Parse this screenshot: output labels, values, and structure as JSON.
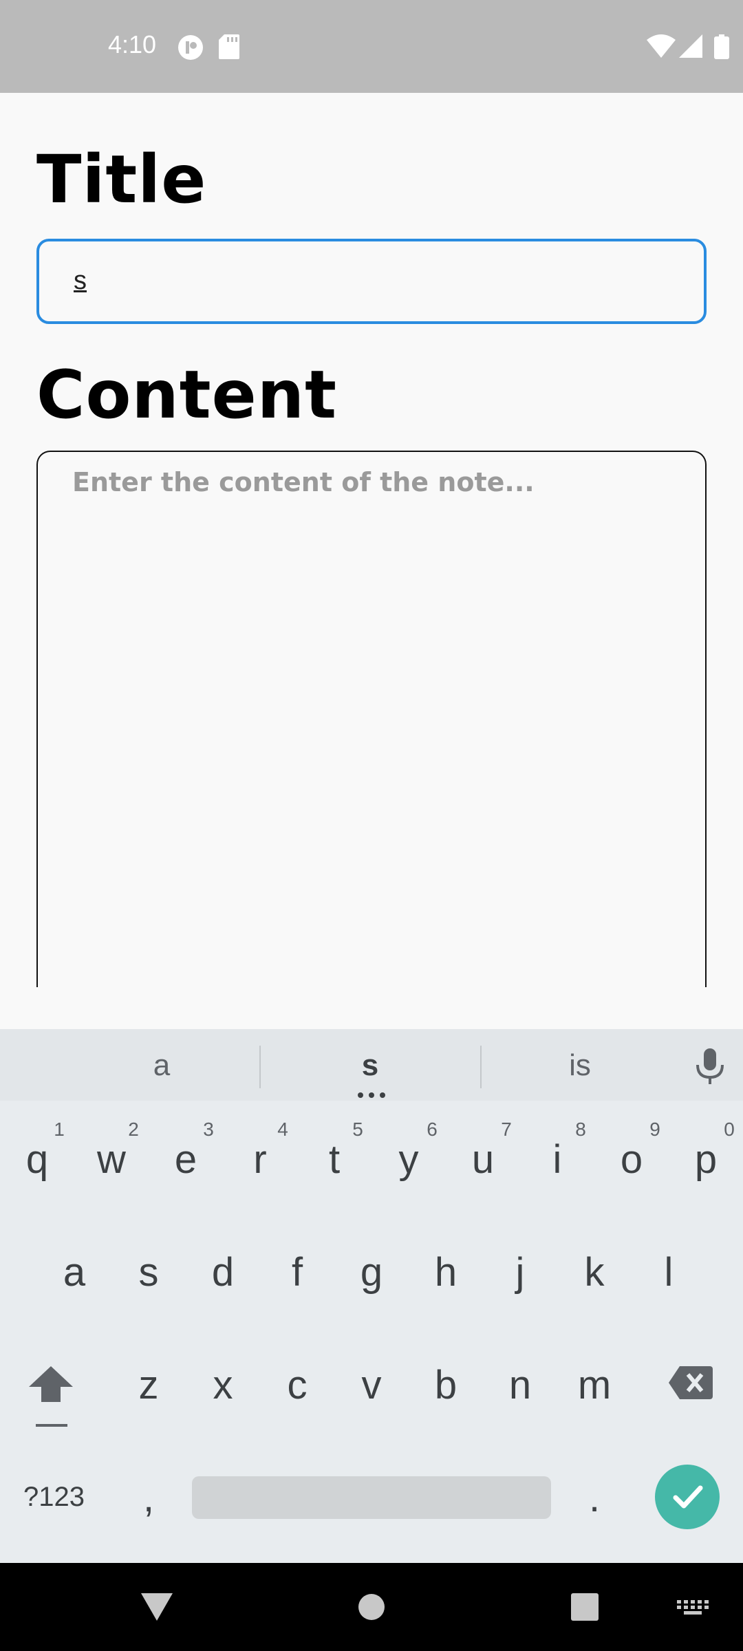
{
  "status_bar": {
    "time": "4:10",
    "left_icons": [
      "app-notification-icon",
      "sd-card-icon"
    ],
    "right_icons": [
      "wifi-icon",
      "cell-signal-icon",
      "battery-icon"
    ]
  },
  "form": {
    "title_label": "Title",
    "title_value": "s",
    "content_label": "Content",
    "content_placeholder": "Enter the content of the note..."
  },
  "keyboard": {
    "suggestions": [
      "a",
      "s",
      "is"
    ],
    "row1": [
      "q",
      "w",
      "e",
      "r",
      "t",
      "y",
      "u",
      "i",
      "o",
      "p"
    ],
    "row1_nums": [
      "1",
      "2",
      "3",
      "4",
      "5",
      "6",
      "7",
      "8",
      "9",
      "0"
    ],
    "row2": [
      "a",
      "s",
      "d",
      "f",
      "g",
      "h",
      "j",
      "k",
      "l"
    ],
    "row3": [
      "z",
      "x",
      "c",
      "v",
      "b",
      "n",
      "m"
    ],
    "symbols_key": "?123",
    "comma_key": ",",
    "period_key": ".",
    "accent_color": "#45b8a8"
  },
  "nav_bar": {
    "buttons": [
      "back-icon",
      "home-icon",
      "recents-icon",
      "keyboard-switch-icon"
    ]
  }
}
